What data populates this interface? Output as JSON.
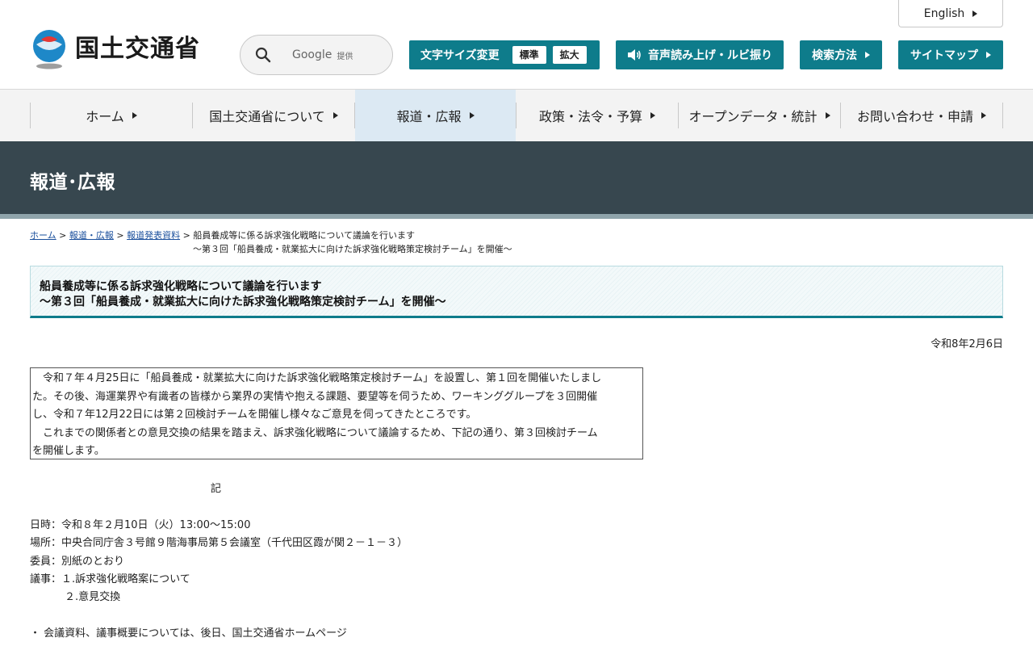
{
  "header": {
    "logo_text": "国土交通省",
    "search": {
      "google": "Google",
      "provided": "提供"
    },
    "english": "English",
    "fontsize": {
      "label": "文字サイズ変更",
      "standard": "標準",
      "large": "拡大"
    },
    "voice": "音声読み上げ・ルビ振り",
    "search_method": "検索方法",
    "sitemap": "サイトマップ"
  },
  "nav": {
    "items": [
      {
        "label": "ホーム"
      },
      {
        "label": "国土交通省について"
      },
      {
        "label": "報道・広報"
      },
      {
        "label": "政策・法令・予算"
      },
      {
        "label": "オープンデータ・統計"
      },
      {
        "label": "お問い合わせ・申請"
      }
    ],
    "active": "報道・広報"
  },
  "band_title": "報道･広報",
  "breadcrumb": {
    "home": "ホーム",
    "sep": ">",
    "press": "報道・広報",
    "releases": "報道発表資料",
    "current_1": "船員養成等に係る訴求強化戦略について議論を行います",
    "current_2": "～第３回「船員養成・就業拡大に向けた訴求強化戦略策定検討チーム」を開催～"
  },
  "heading": {
    "line1": "船員養成等に係る訴求強化戦略について議論を行います",
    "line2": "～第３回「船員養成・就業拡大に向けた訴求強化戦略策定検討チーム」を開催～"
  },
  "date": "令和8年2月6日",
  "intro": {
    "lines": [
      "　令和７年４月25日に「船員養成・就業拡大に向けた訴求強化戦略策定検討チーム」を設置し、第１回を開催いたしまし",
      "た。その後、海運業界や有識者の皆様から業界の実情や抱える課題、要望等を伺うため、ワーキンググループを３回開催",
      "し、令和７年12月22日には第２回検討チームを開催し様々なご意見を伺ってきたところです。",
      "　これまでの関係者との意見交換の結果を踏まえ、訴求強化戦略について議論するため、下記の通り、第３回検討チーム",
      "を開催します。"
    ]
  },
  "ki": "記",
  "details": {
    "datetime": "日時：令和８年２月10日（火）13:00～15:00",
    "place": "場所：中央合同庁舎３号館９階海事局第５会議室（千代田区霞が関２－１－３）",
    "members": "委員：別紙のとおり",
    "agenda1": "議事：１.訴求強化戦略案について",
    "agenda2": "２.意見交換"
  },
  "note": "・ 会議資料、議事概要については、後日、国土交通省ホームページ"
}
